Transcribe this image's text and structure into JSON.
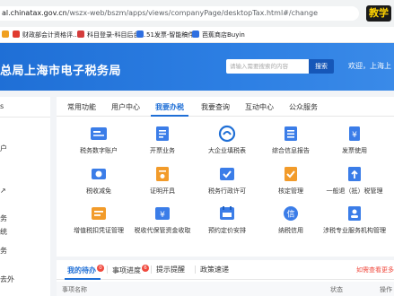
{
  "browser": {
    "url_main": "al.chinatax.gov.cn",
    "url_path": "/wszx-web/bszm/apps/views/companyPage/desktopTax.html#/change",
    "corner_logo_text": "教学"
  },
  "bookmarks": [
    {
      "label": "",
      "color": "#f0a020"
    },
    {
      "label": "财政部会计资格评...",
      "color": "#e03a2f"
    },
    {
      "label": "科目登录-科目后台...",
      "color": "#d43c3c"
    },
    {
      "label": "51发票-智能稿件",
      "color": "#2f6fe0"
    },
    {
      "label": "芭蕉商店Buyin",
      "color": "#2f6fe0"
    }
  ],
  "header": {
    "title": "总局上海市电子税务局",
    "search_placeholder": "请输入需要搜索的内容",
    "search_button": "搜索",
    "welcome": "欢迎，上海上"
  },
  "sidebar": {
    "glyphs": [
      "s",
      "户",
      "↗",
      "务",
      "统",
      "务",
      "去外"
    ]
  },
  "main_tabs": [
    {
      "label": "常用功能"
    },
    {
      "label": "用户中心"
    },
    {
      "label": "我要办税",
      "active": true
    },
    {
      "label": "我要查询"
    },
    {
      "label": "互动中心"
    },
    {
      "label": "公众服务"
    }
  ],
  "grid": [
    {
      "label": "税务数字账户",
      "icon": "tax-account-icon",
      "color": "#3b7de8"
    },
    {
      "label": "开票业务",
      "icon": "invoice-issue-icon",
      "color": "#3b7de8"
    },
    {
      "label": "大企业填税表",
      "icon": "enterprise-icon",
      "color": "#1f6fd6"
    },
    {
      "label": "综合信息报告",
      "icon": "report-icon",
      "color": "#3b7de8"
    },
    {
      "label": "发票使用",
      "icon": "invoice-use-icon",
      "color": "#3b7de8"
    },
    {
      "label": "税收减免",
      "icon": "tax-reduction-icon",
      "color": "#3b7de8"
    },
    {
      "label": "证明开具",
      "icon": "certificate-icon",
      "color": "#f29b2a"
    },
    {
      "label": "税务行政许可",
      "icon": "admin-license-icon",
      "color": "#3b7de8"
    },
    {
      "label": "核定管理",
      "icon": "verify-manage-icon",
      "color": "#f29b2a"
    },
    {
      "label": "一般退（抵）税管理",
      "icon": "tax-refund-icon",
      "color": "#3b7de8"
    },
    {
      "label": "增值税扣凭证管理",
      "icon": "voucher-manage-icon",
      "color": "#f29b2a"
    },
    {
      "label": "税收代保管资金收取",
      "icon": "custody-fund-icon",
      "color": "#3b7de8"
    },
    {
      "label": "预约定价安排",
      "icon": "pricing-arrangement-icon",
      "color": "#3b7de8"
    },
    {
      "label": "纳税信用",
      "icon": "tax-credit-icon",
      "color": "#3b7de8"
    },
    {
      "label": "涉税专业服务机构管理",
      "icon": "agency-manage-icon",
      "color": "#3b7de8"
    }
  ],
  "bottom_tabs": [
    {
      "label": "我的待办",
      "count": "0",
      "active": true
    },
    {
      "label": "事项进度",
      "count": "6"
    },
    {
      "label": "提示提醒"
    },
    {
      "label": "政策速递"
    }
  ],
  "help_link": "如需查看更多",
  "table_headers": [
    "事项名称",
    "状态",
    "操作"
  ]
}
